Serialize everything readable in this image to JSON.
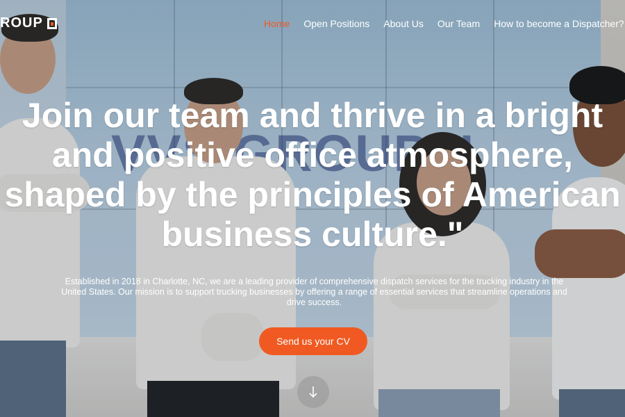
{
  "brand": {
    "logo_text": "ROUP",
    "background_wordmark": "VVS GROUP II",
    "accent_color": "#f05a22"
  },
  "nav": {
    "items": [
      {
        "label": "Home",
        "active": true
      },
      {
        "label": "Open Positions",
        "active": false
      },
      {
        "label": "About Us",
        "active": false
      },
      {
        "label": "Our Team",
        "active": false
      },
      {
        "label": "How to become a Dispatcher?",
        "active": false
      }
    ]
  },
  "hero": {
    "headline": "Join our team and thrive in a bright and positive office atmosphere, shaped by the principles of American business culture.\"",
    "description": "Established in 2018 in Charlotte, NC, we are a leading provider of comprehensive dispatch services for the trucking industry in the United States. Our mission is to support trucking businesses by offering a range of essential services that streamline operations and drive success.",
    "cta_label": "Send us your CV",
    "scroll_icon": "arrow-down-icon"
  }
}
